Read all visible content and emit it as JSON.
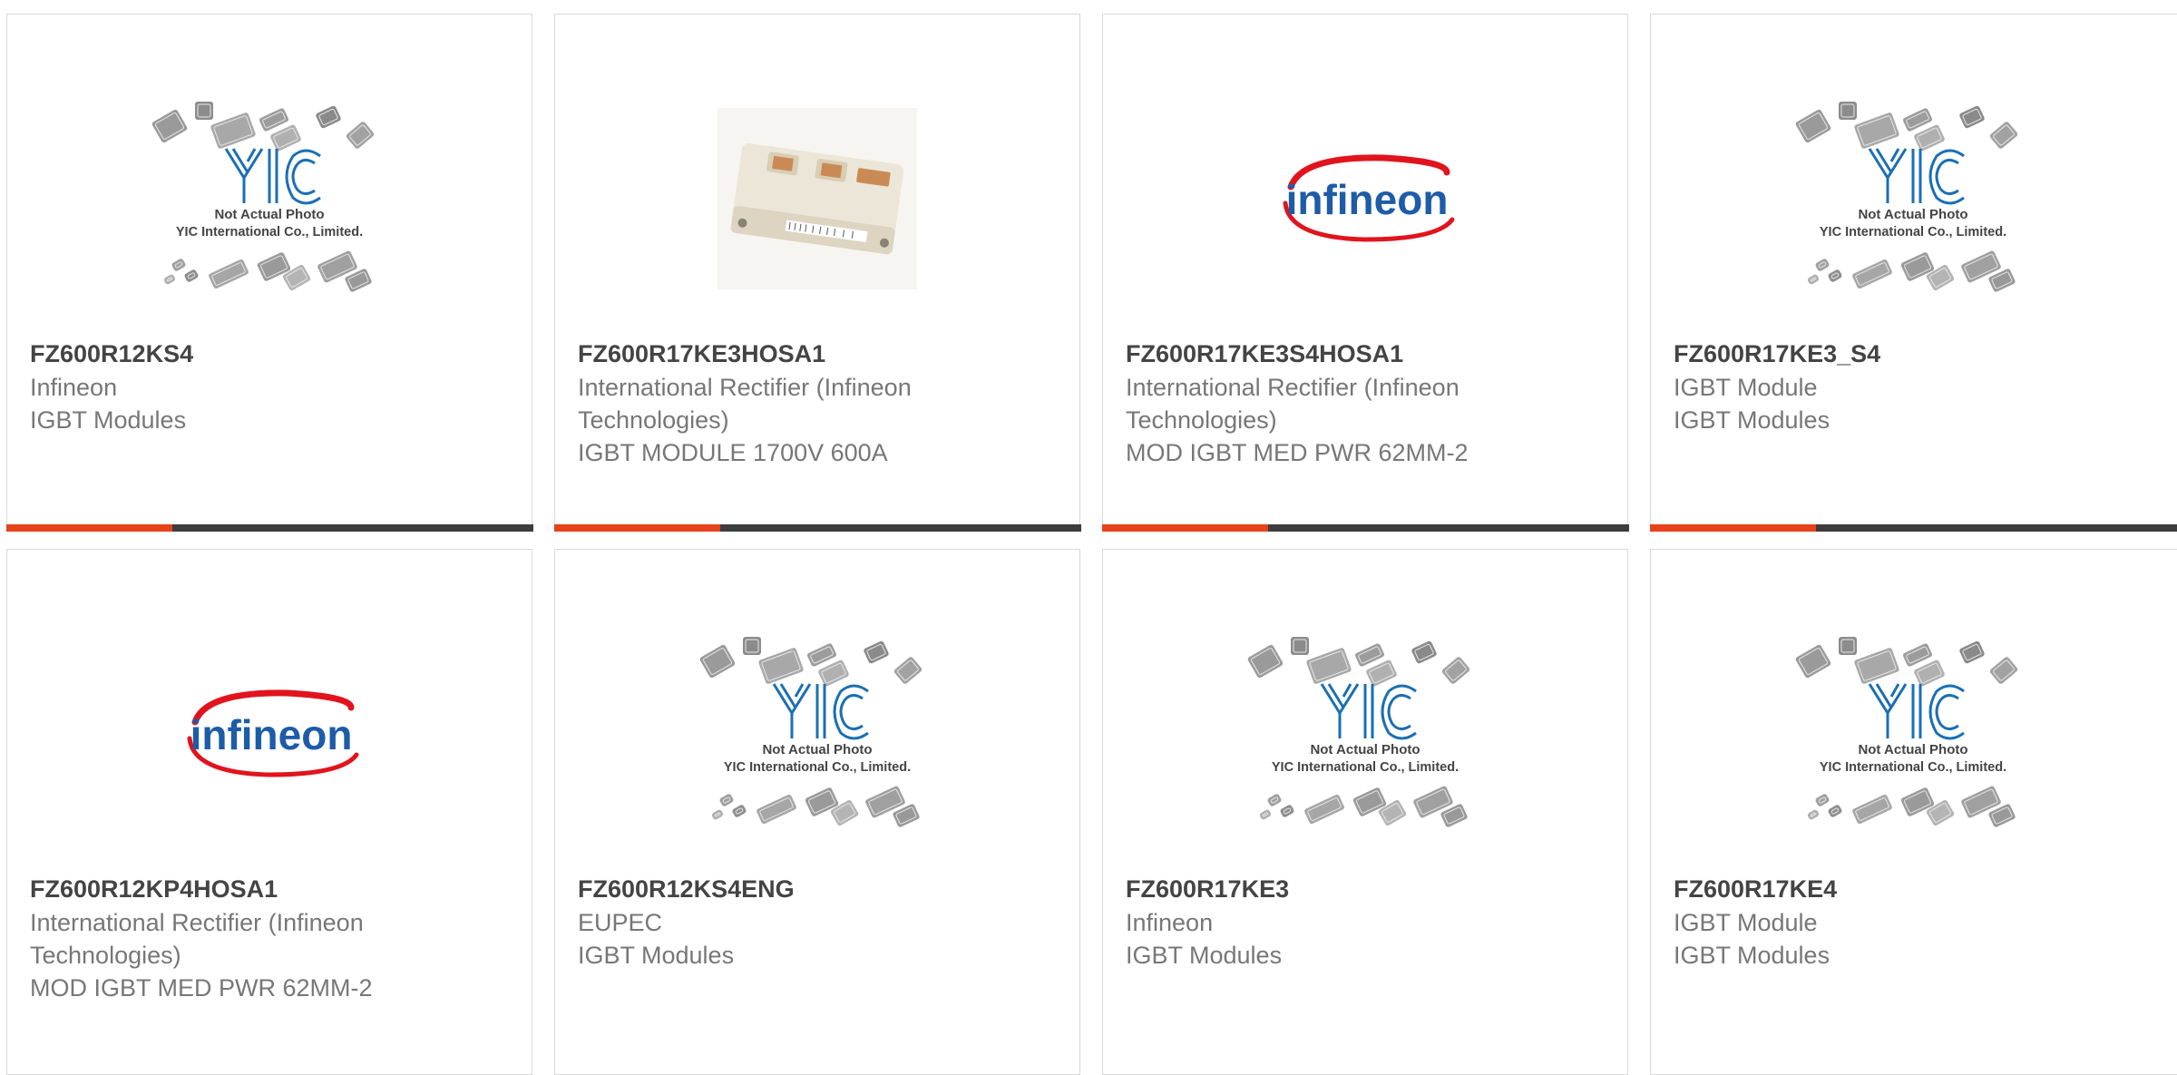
{
  "colors": {
    "accent": "#e8421a",
    "bar_dark": "#3d3d3d",
    "yic_blue": "#1a6fb5",
    "infineon_red": "#e1141e",
    "infineon_blue": "#1d5ca8"
  },
  "products": [
    {
      "part": "FZ600R12KS4",
      "line1": "Infineon",
      "line2": "IGBT Modules",
      "image": "yic-placeholder",
      "placeholder_text1": "Not Actual Photo",
      "placeholder_text2": "YIC International Co., Limited.",
      "logo_word": "YIC"
    },
    {
      "part": "FZ600R17KE3HOSA1",
      "line1": "International Rectifier (Infineon Technologies)",
      "line2": "IGBT MODULE 1700V 600A",
      "image": "igbt-module-photo"
    },
    {
      "part": "FZ600R17KE3S4HOSA1",
      "line1": "International Rectifier (Infineon Technologies)",
      "line2": "MOD IGBT MED PWR 62MM-2",
      "image": "infineon-logo",
      "logo_word": "infineon"
    },
    {
      "part": "FZ600R17KE3_S4",
      "line1": "IGBT Module",
      "line2": "IGBT Modules",
      "image": "yic-placeholder",
      "placeholder_text1": "Not Actual Photo",
      "placeholder_text2": "YIC International Co., Limited.",
      "logo_word": "YIC"
    },
    {
      "part": "FZ600R12KP4HOSA1",
      "line1": "International Rectifier (Infineon Technologies)",
      "line2": "MOD IGBT MED PWR 62MM-2",
      "image": "infineon-logo",
      "logo_word": "infineon"
    },
    {
      "part": "FZ600R12KS4ENG",
      "line1": "EUPEC",
      "line2": "IGBT Modules",
      "image": "yic-placeholder",
      "placeholder_text1": "Not Actual Photo",
      "placeholder_text2": "YIC International Co., Limited.",
      "logo_word": "YIC"
    },
    {
      "part": "FZ600R17KE3",
      "line1": "Infineon",
      "line2": "IGBT Modules",
      "image": "yic-placeholder",
      "placeholder_text1": "Not Actual Photo",
      "placeholder_text2": "YIC International Co., Limited.",
      "logo_word": "YIC"
    },
    {
      "part": "FZ600R17KE4",
      "line1": "IGBT Module",
      "line2": "IGBT Modules",
      "image": "yic-placeholder",
      "placeholder_text1": "Not Actual Photo",
      "placeholder_text2": "YIC International Co., Limited.",
      "logo_word": "YIC"
    }
  ]
}
